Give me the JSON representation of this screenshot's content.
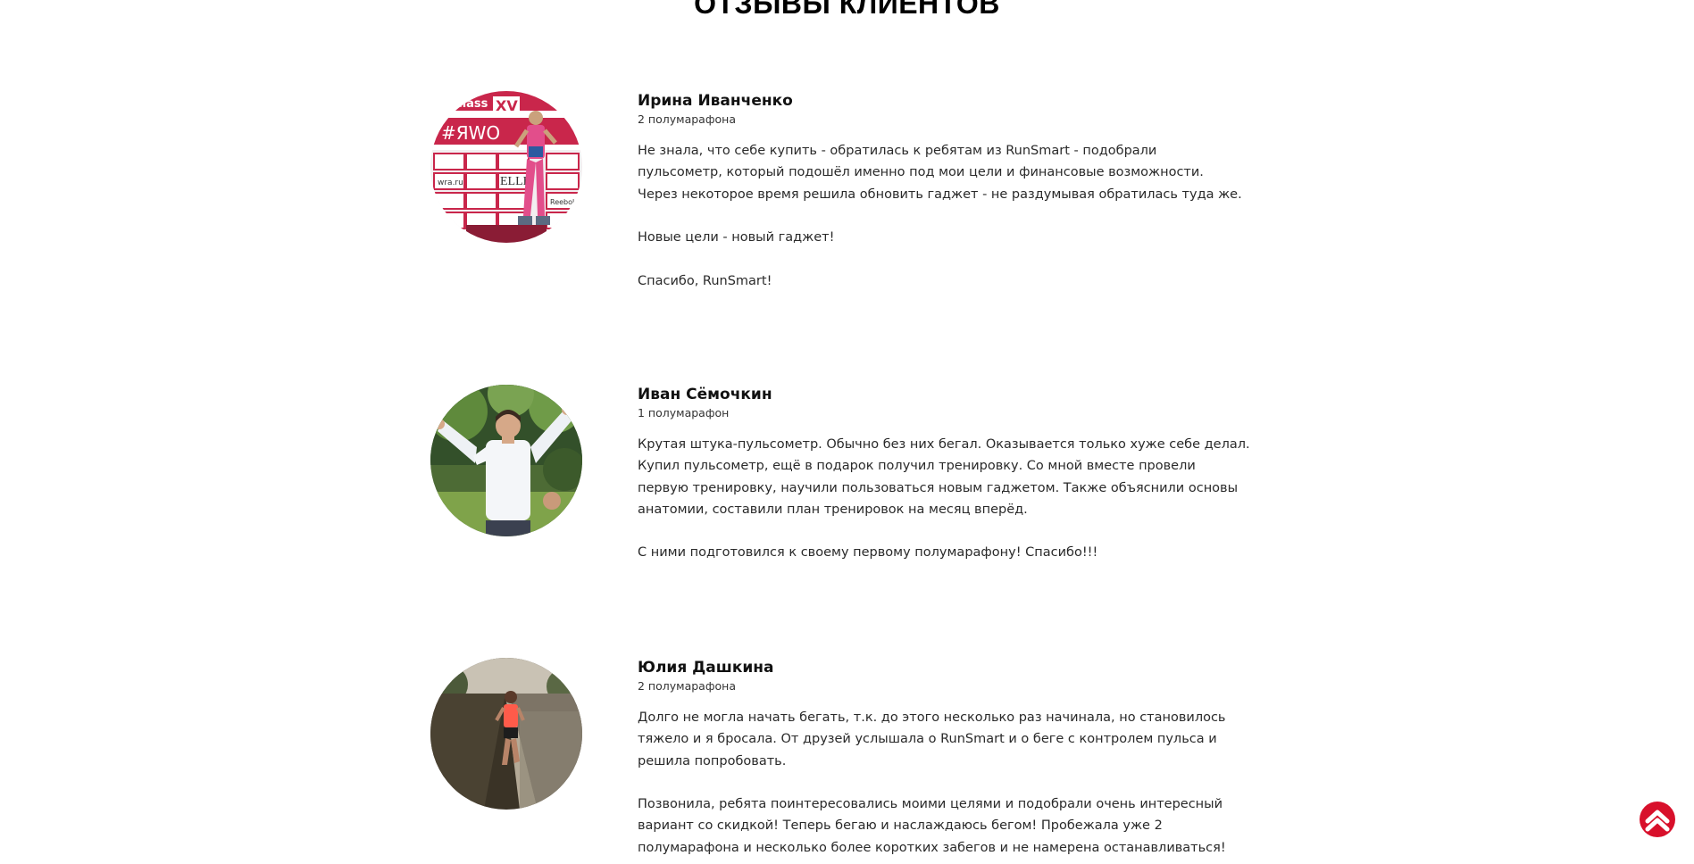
{
  "section": {
    "title": "ОТЗЫВЫ КЛИЕНТОВ"
  },
  "reviews": [
    {
      "name": "Ирина Иванченко",
      "meta": "2 полумарафона",
      "lines": [
        "Не знала, что себе купить - обратилась к ребятам из RunSmart - подобрали",
        "пульсометр, который подошёл именно под мои цели и финансовые возможности.",
        "Через некоторое время решила обновить гаджет - не раздумывая обратилась туда же.",
        "",
        "Новые цели - новый гаджет!",
        "",
        "Спасибо, RunSmart!"
      ],
      "photo_text": {
        "brand": "class",
        "roman": "XV",
        "hashtag": "#ЯWO",
        "magazine": "ELLE",
        "site": "wra.ru",
        "sponsor": "Reebok"
      }
    },
    {
      "name": "Иван Сёмочкин",
      "meta": "1 полумарафон",
      "lines": [
        "Крутая штука-пульсометр. Обычно без них бегал. Оказывается только хуже себе делал.",
        "Купил пульсометр, ещё в подарок получил тренировку. Со мной вместе провели",
        "первую тренировку, научили пользоваться новым гаджетом. Также объяснили основы",
        "анатомии, составили план тренировок на месяц вперёд.",
        "",
        "С ними подготовился к своему первому полумарафону! Спасибо!!!"
      ]
    },
    {
      "name": "Юлия Дашкина",
      "meta": "2 полумарафона",
      "lines": [
        "Долго не могла начать бегать, т.к. до этого несколько раз начинала, но становилось",
        "тяжело и я бросала. От друзей услышала о RunSmart и о беге с контролем пульса и",
        "решила попробовать.",
        "",
        "Позвонила, ребята поинтересовались моими целями и подобрали очень интересный",
        "вариант со скидкой! Теперь бегаю и наслаждаюсь бегом! Пробежала уже 2",
        "полумарафона и несколько более коротких забегов и не намерена останавливаться!"
      ]
    }
  ],
  "scroll_top": {
    "icon": "chevron-up-icon"
  },
  "colors": {
    "accent": "#d8102b",
    "text": "#2a2a2a"
  }
}
